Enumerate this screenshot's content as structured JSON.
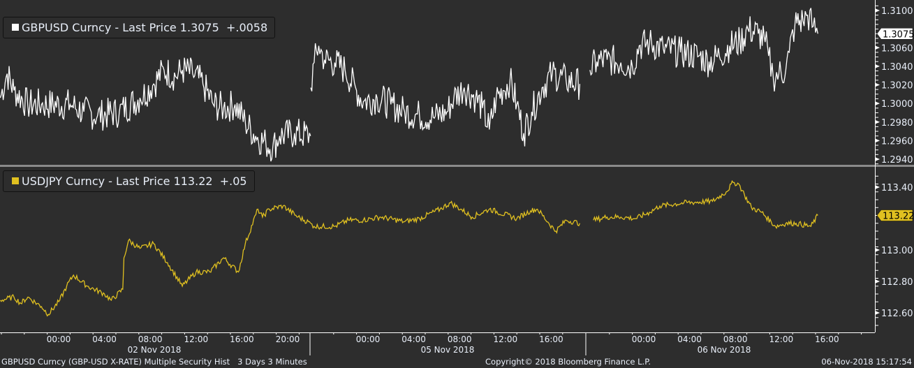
{
  "colors": {
    "background": "#2d2d2d",
    "gbpusd": "#ffffff",
    "usdjpy": "#e0c020",
    "axis_text": "#e8eef8",
    "separator": "#8a8a8a"
  },
  "footer": {
    "left": "GBPUSD Curncy (GBP-USD X-RATE) Multiple Security Hist   3 Days 3 Minutes",
    "center": "Copyright© 2018 Bloomberg Finance L.P.",
    "right": "06-Nov-2018 15:17:54"
  },
  "chart_data": [
    {
      "type": "line",
      "name": "GBPUSD",
      "legend": {
        "security": "GBPUSD Curncy - Last Price",
        "last": "1.3075",
        "change": "+.0058"
      },
      "last_price_tag": "1.3075",
      "ylim": [
        1.2935,
        1.3112
      ],
      "yticks": [
        "1.3100",
        "1.3060",
        "1.3040",
        "1.3020",
        "1.3000",
        "1.2980",
        "1.2960",
        "1.2940"
      ],
      "sessions": [
        {
          "session": "02 Nov 2018",
          "points": [
            [
              -5.1,
              1.3006
            ],
            [
              -4.5,
              1.3032
            ],
            [
              -3.9,
              1.3014
            ],
            [
              -2.7,
              1.2999
            ],
            [
              -1.5,
              1.2999
            ],
            [
              1.0,
              1.2999
            ],
            [
              2.2,
              1.2991
            ],
            [
              3.4,
              1.2987
            ],
            [
              5.3,
              1.2991
            ],
            [
              7.1,
              1.3006
            ],
            [
              8.3,
              1.3021
            ],
            [
              9.2,
              1.3036
            ],
            [
              10.2,
              1.3029
            ],
            [
              10.8,
              1.3036
            ],
            [
              11.7,
              1.3032
            ],
            [
              12.6,
              1.3021
            ],
            [
              13.5,
              1.2999
            ],
            [
              14.4,
              1.2995
            ],
            [
              15.4,
              1.2999
            ],
            [
              16.3,
              1.298
            ],
            [
              17.2,
              1.2965
            ],
            [
              18.1,
              1.2957
            ],
            [
              18.7,
              1.2953
            ],
            [
              19.3,
              1.2965
            ],
            [
              20.6,
              1.2968
            ],
            [
              22.0,
              1.2965
            ]
          ]
        },
        {
          "session": "05 Nov 2018",
          "points": [
            [
              -5.0,
              1.3017
            ],
            [
              -4.7,
              1.3044
            ],
            [
              -4.3,
              1.3062
            ],
            [
              -3.8,
              1.3047
            ],
            [
              -2.9,
              1.3044
            ],
            [
              -2.0,
              1.3036
            ],
            [
              -1.0,
              1.3014
            ],
            [
              -0.4,
              1.3002
            ],
            [
              0.8,
              1.3006
            ],
            [
              2.0,
              1.2999
            ],
            [
              3.2,
              1.2991
            ],
            [
              4.5,
              1.2987
            ],
            [
              5.7,
              1.2985
            ],
            [
              6.9,
              1.2991
            ],
            [
              7.5,
              1.3006
            ],
            [
              8.4,
              1.3017
            ],
            [
              9.4,
              1.3006
            ],
            [
              10.0,
              1.2995
            ],
            [
              10.6,
              1.2972
            ],
            [
              11.2,
              1.3006
            ],
            [
              11.8,
              1.3014
            ],
            [
              12.4,
              1.3025
            ],
            [
              13.0,
              1.2999
            ],
            [
              13.6,
              1.2968
            ],
            [
              14.3,
              1.2991
            ],
            [
              15.2,
              1.3017
            ],
            [
              16.1,
              1.3032
            ],
            [
              17.3,
              1.3025
            ],
            [
              18.5,
              1.3021
            ]
          ]
        },
        {
          "session": "06 Nov 2018",
          "points": [
            [
              -4.7,
              1.3036
            ],
            [
              -4.1,
              1.3045
            ],
            [
              -3.2,
              1.3047
            ],
            [
              -2.0,
              1.3044
            ],
            [
              -1.0,
              1.304
            ],
            [
              -0.4,
              1.3062
            ],
            [
              0.5,
              1.3065
            ],
            [
              1.7,
              1.3059
            ],
            [
              3.2,
              1.3055
            ],
            [
              4.8,
              1.3051
            ],
            [
              5.7,
              1.3045
            ],
            [
              6.6,
              1.3051
            ],
            [
              7.5,
              1.3062
            ],
            [
              8.4,
              1.3066
            ],
            [
              9.1,
              1.308
            ],
            [
              10.0,
              1.3075
            ],
            [
              10.6,
              1.3066
            ],
            [
              10.9,
              1.3051
            ],
            [
              11.3,
              1.3029
            ],
            [
              11.8,
              1.3032
            ],
            [
              12.4,
              1.3036
            ],
            [
              12.7,
              1.3055
            ],
            [
              13.2,
              1.3085
            ],
            [
              13.9,
              1.3089
            ],
            [
              14.3,
              1.3095
            ],
            [
              14.8,
              1.3083
            ],
            [
              15.2,
              1.3075
            ]
          ]
        }
      ]
    },
    {
      "type": "line",
      "name": "USDJPY",
      "legend": {
        "security": "USDJPY Curncy - Last Price",
        "last": "113.22",
        "change": "+.05"
      },
      "last_price_tag": "113.22",
      "ylim": [
        112.52,
        113.52
      ],
      "yticks": [
        "113.40",
        "113.00",
        "112.80",
        "112.60"
      ],
      "sessions": [
        {
          "session": "02 Nov 2018",
          "points": [
            [
              -5.1,
              112.68
            ],
            [
              -3.9,
              112.7
            ],
            [
              -3.3,
              112.66
            ],
            [
              -2.7,
              112.7
            ],
            [
              -1.5,
              112.64
            ],
            [
              -0.9,
              112.59
            ],
            [
              0.1,
              112.68
            ],
            [
              0.7,
              112.77
            ],
            [
              1.3,
              112.84
            ],
            [
              2.5,
              112.77
            ],
            [
              4.0,
              112.72
            ],
            [
              4.6,
              112.68
            ],
            [
              5.6,
              112.75
            ],
            [
              5.7,
              112.95
            ],
            [
              6.1,
              113.06
            ],
            [
              7.1,
              113.01
            ],
            [
              8.3,
              113.04
            ],
            [
              9.5,
              112.92
            ],
            [
              10.8,
              112.77
            ],
            [
              12.0,
              112.86
            ],
            [
              13.2,
              112.86
            ],
            [
              14.4,
              112.95
            ],
            [
              15.7,
              112.86
            ],
            [
              16.3,
              113.04
            ],
            [
              17.4,
              113.26
            ],
            [
              17.8,
              113.21
            ],
            [
              18.4,
              113.26
            ],
            [
              19.6,
              113.28
            ],
            [
              20.9,
              113.21
            ],
            [
              22.0,
              113.17
            ]
          ]
        },
        {
          "session": "05 Nov 2018",
          "points": [
            [
              -5.0,
              113.17
            ],
            [
              -4.7,
              113.15
            ],
            [
              -2.9,
              113.15
            ],
            [
              -1.7,
              113.19
            ],
            [
              -0.4,
              113.19
            ],
            [
              1.1,
              113.21
            ],
            [
              3.2,
              113.18
            ],
            [
              4.5,
              113.2
            ],
            [
              6.3,
              113.26
            ],
            [
              7.2,
              113.3
            ],
            [
              8.1,
              113.26
            ],
            [
              9.1,
              113.21
            ],
            [
              10.6,
              113.26
            ],
            [
              13.0,
              113.2
            ],
            [
              14.2,
              113.25
            ],
            [
              14.8,
              113.26
            ],
            [
              15.8,
              113.17
            ],
            [
              16.4,
              113.12
            ],
            [
              17.3,
              113.19
            ],
            [
              18.5,
              113.17
            ]
          ]
        },
        {
          "session": "06 Nov 2018",
          "points": [
            [
              -4.4,
              113.19
            ],
            [
              -3.2,
              113.21
            ],
            [
              -2.0,
              113.21
            ],
            [
              -0.7,
              113.2
            ],
            [
              0.5,
              113.24
            ],
            [
              1.4,
              113.28
            ],
            [
              3.5,
              113.3
            ],
            [
              6.0,
              113.31
            ],
            [
              7.2,
              113.37
            ],
            [
              7.8,
              113.43
            ],
            [
              8.3,
              113.42
            ],
            [
              8.8,
              113.35
            ],
            [
              9.4,
              113.27
            ],
            [
              10.3,
              113.24
            ],
            [
              11.5,
              113.15
            ],
            [
              12.4,
              113.17
            ],
            [
              13.3,
              113.17
            ],
            [
              14.6,
              113.15
            ],
            [
              15.2,
              113.22
            ]
          ]
        }
      ]
    }
  ],
  "xaxis": {
    "sessions": [
      {
        "date": "02 Nov 2018",
        "ticks": [
          "00:00",
          "04:00",
          "08:00",
          "12:00",
          "16:00",
          "20:00"
        ]
      },
      {
        "date": "05 Nov 2018",
        "ticks": [
          "00:00",
          "04:00",
          "08:00",
          "12:00",
          "16:00"
        ]
      },
      {
        "date": "06 Nov 2018",
        "ticks": [
          "00:00",
          "04:00",
          "08:00",
          "12:00",
          "16:00"
        ]
      }
    ]
  }
}
